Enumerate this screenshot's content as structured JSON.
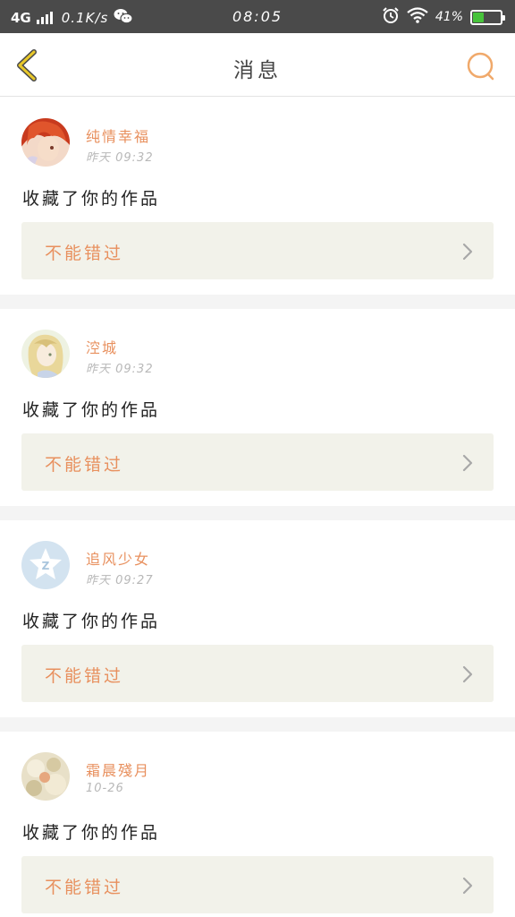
{
  "status_bar": {
    "network": "4G",
    "speed": "0.1K/s",
    "time": "08:05",
    "battery": "41%",
    "battery_level": 0.41,
    "battery_color": "#47c33b",
    "icons": [
      "signal-icon",
      "wechat-icon",
      "alarm-icon",
      "wifi-icon",
      "battery-icon"
    ]
  },
  "header": {
    "title": "消息",
    "back_icon": "chevron-left-icon",
    "search_icon": "search-icon",
    "accent_back": "#e8c82a",
    "accent_search": "#f0a96b"
  },
  "messages": [
    {
      "name": "纯情幸福",
      "time": "昨天 09:32",
      "action": "收藏了你的作品",
      "work": "不能错过"
    },
    {
      "name": "涳城",
      "time": "昨天 09:32",
      "action": "收藏了你的作品",
      "work": "不能错过"
    },
    {
      "name": "追风少女",
      "time": "昨天 09:27",
      "action": "收藏了你的作品",
      "work": "不能错过"
    },
    {
      "name": "霜晨殘月",
      "time": "10-26",
      "action": "收藏了你的作品",
      "work": "不能错过"
    }
  ],
  "colors": {
    "name": "#e8905e",
    "work_box_bg": "#f2f2ea",
    "divider": "#f4f4f4"
  }
}
